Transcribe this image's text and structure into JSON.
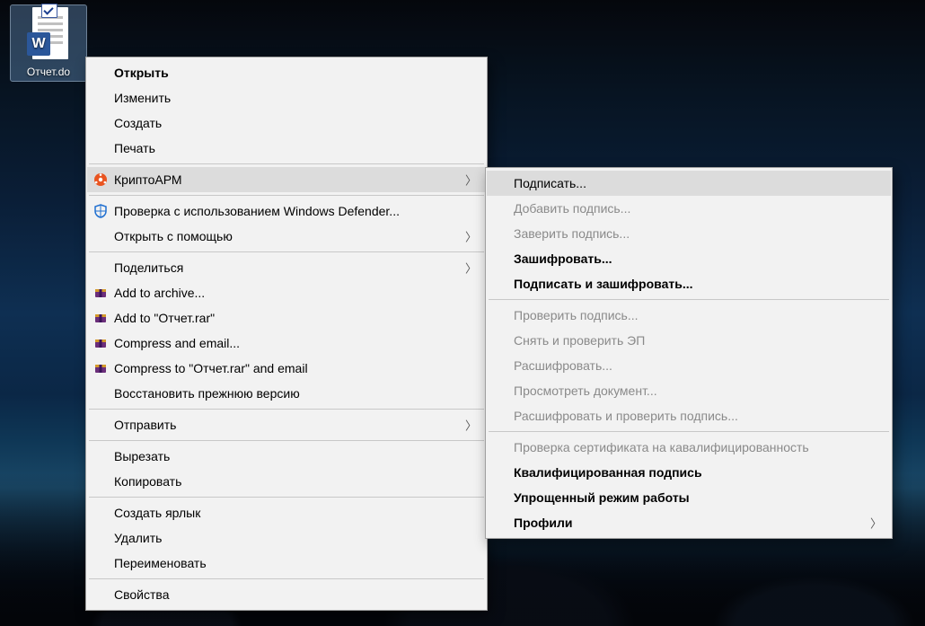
{
  "desktop": {
    "file_label": "Отчет.do"
  },
  "menu": {
    "open": "Открыть",
    "edit": "Изменить",
    "create": "Создать",
    "print": "Печать",
    "cryptoarm": "КриптоАРМ",
    "defender": "Проверка с использованием Windows Defender...",
    "open_with": "Открыть с помощью",
    "share": "Поделиться",
    "add_archive": "Add to archive...",
    "add_rar": "Add to \"Отчет.rar\"",
    "compress_email": "Compress and email...",
    "compress_rar_email": "Compress to \"Отчет.rar\" and email",
    "restore_prev": "Восстановить прежнюю версию",
    "send_to": "Отправить",
    "cut": "Вырезать",
    "copy": "Копировать",
    "create_shortcut": "Создать ярлык",
    "delete": "Удалить",
    "rename": "Переименовать",
    "properties": "Свойства"
  },
  "submenu": {
    "sign": "Подписать...",
    "add_sign": "Добавить подпись...",
    "certify_sign": "Заверить подпись...",
    "encrypt": "Зашифровать...",
    "sign_encrypt": "Подписать и зашифровать...",
    "verify_sign": "Проверить подпись...",
    "remove_verify": "Снять и проверить ЭП",
    "decrypt": "Расшифровать...",
    "view_doc": "Просмотреть документ...",
    "decrypt_verify": "Расшифровать и проверить подпись...",
    "cert_qualified_check": "Проверка сертификата на кавалифицированность",
    "qualified_sign": "Квалифицированная подпись",
    "simple_mode": "Упрощенный режим работы",
    "profiles": "Профили"
  }
}
